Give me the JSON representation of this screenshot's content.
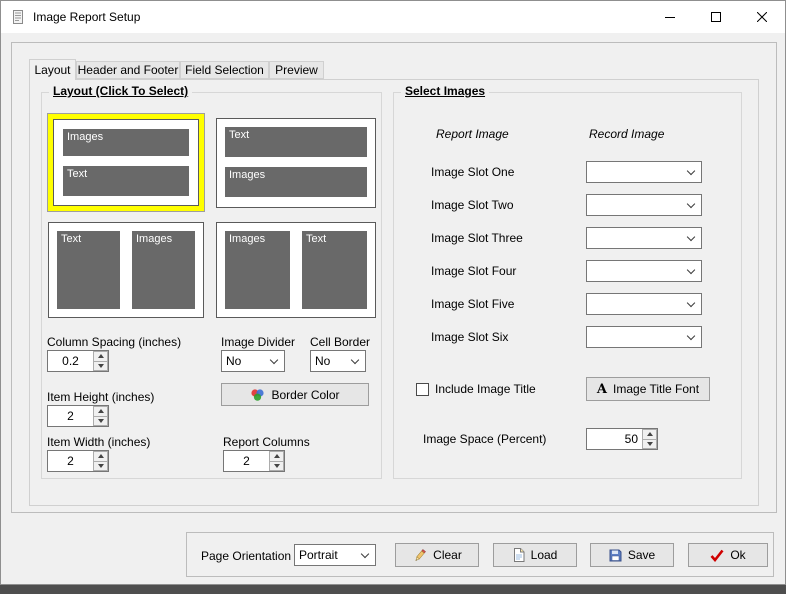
{
  "window": {
    "title": "Image Report Setup"
  },
  "tabs": [
    {
      "label": "Layout"
    },
    {
      "label": "Header and Footer"
    },
    {
      "label": "Field Selection"
    },
    {
      "label": "Preview"
    }
  ],
  "layout_group": {
    "title": "Layout (Click To Select)",
    "previews": {
      "p1": {
        "bar1": "Images",
        "bar2": "Text",
        "selected": true
      },
      "p2": {
        "bar1": "Text",
        "bar2": "Images",
        "selected": false
      },
      "p3": {
        "col1": "Text",
        "col2": "Images",
        "selected": false
      },
      "p4": {
        "col1": "Images",
        "col2": "Text",
        "selected": false
      }
    },
    "column_spacing_label": "Column Spacing (inches)",
    "column_spacing_value": "0.2",
    "image_divider_label": "Image Divider",
    "image_divider_value": "No",
    "cell_border_label": "Cell Border",
    "cell_border_value": "No",
    "border_color_button": "Border Color",
    "item_height_label": "Item Height (inches)",
    "item_height_value": "2",
    "item_width_label": "Item Width (inches)",
    "item_width_value": "2",
    "report_columns_label": "Report Columns",
    "report_columns_value": "2"
  },
  "select_images": {
    "title": "Select Images",
    "report_image_header": "Report Image",
    "record_image_header": "Record Image",
    "slots": [
      {
        "label": "Image Slot One",
        "value": ""
      },
      {
        "label": "Image Slot Two",
        "value": ""
      },
      {
        "label": "Image Slot Three",
        "value": ""
      },
      {
        "label": "Image Slot Four",
        "value": ""
      },
      {
        "label": "Image Slot Five",
        "value": ""
      },
      {
        "label": "Image Slot Six",
        "value": ""
      }
    ],
    "include_image_title_label": "Include Image Title",
    "include_image_title_checked": false,
    "image_title_font_button": "Image Title Font",
    "image_space_label": "Image Space (Percent)",
    "image_space_value": "50"
  },
  "bottom_bar": {
    "page_orientation_label": "Page Orientation",
    "page_orientation_value": "Portrait",
    "clear_button": "Clear",
    "load_button": "Load",
    "save_button": "Save",
    "ok_button": "Ok"
  },
  "colors": {
    "selection_highlight": "#ffff00",
    "preview_bar": "#696969",
    "ok_check": "#cf0000"
  }
}
